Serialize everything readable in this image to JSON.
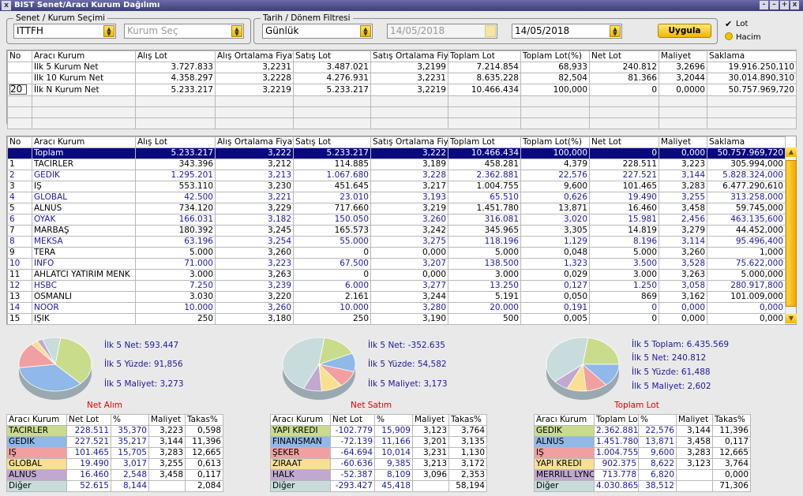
{
  "window": {
    "title": "BIST Senet/Aracı Kurum Dağılımı",
    "close": "x",
    "controls": [
      "-",
      "–",
      "+",
      "x"
    ]
  },
  "filters": {
    "senet_group": "Senet / Kurum Seçimi",
    "senet": "ITTFH",
    "kurum_placeholder": "Kurum Seç",
    "date_group": "Tarih / Dönem Filtresi",
    "period": "Günlük",
    "date_from": "14/05/2018",
    "date_to": "14/05/2018",
    "apply": "Uygula",
    "radio_lot": "Lot",
    "radio_hacim": "Hacim"
  },
  "colors": {
    "pie": [
      "#c8dc8c",
      "#90b8e8",
      "#f0a0a0",
      "#f8e090",
      "#c0a8d0",
      "#c8dcdc"
    ],
    "selected_row": "#0a0a80",
    "blue_text": "#1a1a9a",
    "accent": "#f2b600"
  },
  "summary": {
    "headers": [
      "No",
      "Aracı Kurum",
      "Alış Lot",
      "Alış Ortalama Fiyat",
      "Satış Lot",
      "Satış Ortalama Fiyat",
      "Toplam Lot",
      "Toplam Lot(%)",
      "Net Lot",
      "Maliyet",
      "Saklama"
    ],
    "n_value": "20",
    "rows": [
      [
        "",
        "İlk 5 Kurum Net",
        "3.727.833",
        "3,2231",
        "3.487.021",
        "3,2199",
        "7.214.854",
        "68,933",
        "240.812",
        "3,2696",
        "19.916.250,110"
      ],
      [
        "",
        "İlk 10 Kurum Net",
        "4.358.297",
        "3,2228",
        "4.276.931",
        "3,2231",
        "8.635.228",
        "82,504",
        "81.366",
        "3,2044",
        "30.014.890,310"
      ],
      [
        "",
        "İlk N Kurum Net",
        "5.233.217",
        "3,2219",
        "5.233.217",
        "3,2219",
        "10.466.434",
        "100,000",
        "0",
        "0,0000",
        "50.757.969,720"
      ]
    ]
  },
  "detail": {
    "headers": [
      "No",
      "Aracı Kurum",
      "Alış Lot",
      "Alış Ortalama Fiyat",
      "Satış Lot",
      "Satış Ortalama Fiya",
      "Toplam Lot",
      "Toplam Lot(%)",
      "Net Lot",
      "Maliyet",
      "Saklama"
    ],
    "rows": [
      [
        "",
        "Toplam",
        "5.233.217",
        "3,222",
        "5.233.217",
        "3,222",
        "10.466.434",
        "100,000",
        "0",
        "0,000",
        "50.757.969,720"
      ],
      [
        "1",
        "TACİRLER",
        "343.396",
        "3,212",
        "114.885",
        "3,189",
        "458.281",
        "4,379",
        "228.511",
        "3,223",
        "305.994,000"
      ],
      [
        "2",
        "GEDİK",
        "1.295.201",
        "3,213",
        "1.067.680",
        "3,228",
        "2.362.881",
        "22,576",
        "227.521",
        "3,144",
        "5.828.324,000"
      ],
      [
        "3",
        "İŞ",
        "553.110",
        "3,230",
        "451.645",
        "3,217",
        "1.004.755",
        "9,600",
        "101.465",
        "3,283",
        "6.477.290,610"
      ],
      [
        "4",
        "GLOBAL",
        "42.500",
        "3,221",
        "23.010",
        "3,193",
        "65.510",
        "0,626",
        "19.490",
        "3,255",
        "313.258,000"
      ],
      [
        "5",
        "ALNUS",
        "734.120",
        "3,229",
        "717.660",
        "3,219",
        "1.451.780",
        "13,871",
        "16.460",
        "3,458",
        "59.745,000"
      ],
      [
        "6",
        "OYAK",
        "166.031",
        "3,182",
        "150.050",
        "3,260",
        "316.081",
        "3,020",
        "15.981",
        "2,456",
        "463.135,600"
      ],
      [
        "7",
        "MARBAŞ",
        "180.392",
        "3,245",
        "165.573",
        "3,242",
        "345.965",
        "3,305",
        "14.819",
        "3,279",
        "44.452,000"
      ],
      [
        "8",
        "MEKSA",
        "63.196",
        "3,254",
        "55.000",
        "3,275",
        "118.196",
        "1,129",
        "8.196",
        "3,114",
        "95.496,400"
      ],
      [
        "9",
        "TERA",
        "5.000",
        "3,260",
        "0",
        "0,000",
        "5.000",
        "0,048",
        "5.000",
        "3,260",
        "1,000"
      ],
      [
        "10",
        "İNFO",
        "71.000",
        "3,223",
        "67.500",
        "3,207",
        "138.500",
        "1,323",
        "3.500",
        "3,528",
        "75.622,000"
      ],
      [
        "11",
        "AHLATCI YATIRIM MENK",
        "3.000",
        "3,263",
        "0",
        "0,000",
        "3.000",
        "0,029",
        "3.000",
        "3,263",
        "5.000,000"
      ],
      [
        "12",
        "HSBC",
        "7.250",
        "3,239",
        "6.000",
        "3,277",
        "13.250",
        "0,127",
        "1.250",
        "3,058",
        "280.917,800"
      ],
      [
        "13",
        "OSMANLI",
        "3.030",
        "3,220",
        "2.161",
        "3,244",
        "5.191",
        "0,050",
        "869",
        "3,162",
        "101.009,000"
      ],
      [
        "14",
        "NOOR",
        "10.000",
        "3,260",
        "10.000",
        "3,280",
        "20.000",
        "0,191",
        "0",
        "0,000",
        "0,000"
      ],
      [
        "15",
        "IŞIK",
        "250",
        "3,180",
        "250",
        "3,190",
        "500",
        "0,005",
        "0",
        "0,000",
        "0,000"
      ]
    ],
    "scroll_up": "▲",
    "scroll_down": "▼"
  },
  "charts": [
    {
      "title": "Net Alım",
      "labels": [
        "İlk 5 Net: 593.447",
        "İlk 5 Yüzde: 91,856",
        "İlk 5 Maliyet: 3,273"
      ],
      "pie_values": [
        228.511,
        227.521,
        101.465,
        19.49,
        16.46,
        52.615
      ],
      "headers": [
        "Aracı Kurum",
        "Net Lot",
        "%",
        "Maliyet",
        "Takas%"
      ],
      "rows": [
        [
          "TACİRLER",
          "228.511",
          "35,370",
          "3,223",
          "0,598"
        ],
        [
          "GEDİK",
          "227.521",
          "35,217",
          "3,144",
          "11,396"
        ],
        [
          "İŞ",
          "101.465",
          "15,705",
          "3,283",
          "12,665"
        ],
        [
          "GLOBAL",
          "19.490",
          "3,017",
          "3,255",
          "0,613"
        ],
        [
          "ALNUS",
          "16.460",
          "2,548",
          "3,458",
          "0,117"
        ],
        [
          "Diğer",
          "52.615",
          "8,144",
          "",
          "2,084"
        ]
      ]
    },
    {
      "title": "Net Satım",
      "labels": [
        "İlk 5 Net: -352.635",
        "İlk 5 Yüzde: 54,582",
        "İlk 5 Maliyet: 3,173"
      ],
      "pie_values": [
        102.779,
        72.139,
        64.694,
        60.636,
        52.387,
        293.427
      ],
      "headers": [
        "Aracı Kurum",
        "Net Lot",
        "%",
        "Maliyet",
        "Takas%"
      ],
      "rows": [
        [
          "YAPI KREDİ",
          "-102.779",
          "15,909",
          "3,123",
          "3,764"
        ],
        [
          "FİNANSMAN",
          "-72.139",
          "11,166",
          "3,201",
          "3,135"
        ],
        [
          "ŞEKER",
          "-64.694",
          "10,014",
          "3,231",
          "1,130"
        ],
        [
          "ZİRAAT",
          "-60.636",
          "9,385",
          "3,213",
          "3,172"
        ],
        [
          "HALK",
          "-52.387",
          "8,109",
          "3,096",
          "2,353"
        ],
        [
          "Diğer",
          "-293.427",
          "45,418",
          "",
          "58,194"
        ]
      ]
    },
    {
      "title": "Toplam Lot",
      "labels": [
        "İlk 5 Toplam: 6.435.569",
        "İlk 5 Net: 240.812",
        "İlk 5 Yüzde: 61,488",
        "İlk 5 Maliyet: 2,602"
      ],
      "pie_values": [
        2362.881,
        1451.78,
        1004.755,
        902.375,
        713.778,
        4030.865
      ],
      "headers": [
        "Aracı Kurum",
        "Toplam Lot",
        "%",
        "Maliyet",
        "Takas%"
      ],
      "rows": [
        [
          "GEDİK",
          "2.362.881",
          "22,576",
          "3,144",
          "11,396"
        ],
        [
          "ALNUS",
          "1.451.780",
          "13,871",
          "3,458",
          "0,117"
        ],
        [
          "İŞ",
          "1.004.755",
          "9,600",
          "3,283",
          "12,665"
        ],
        [
          "YAPI KREDİ",
          "902.375",
          "8,622",
          "3,123",
          "3,764"
        ],
        [
          "MERRILL LYNC",
          "713.778",
          "6,820",
          "",
          "0,000"
        ],
        [
          "Diğer",
          "4.030.865",
          "38,512",
          "",
          "71,306"
        ]
      ]
    }
  ]
}
